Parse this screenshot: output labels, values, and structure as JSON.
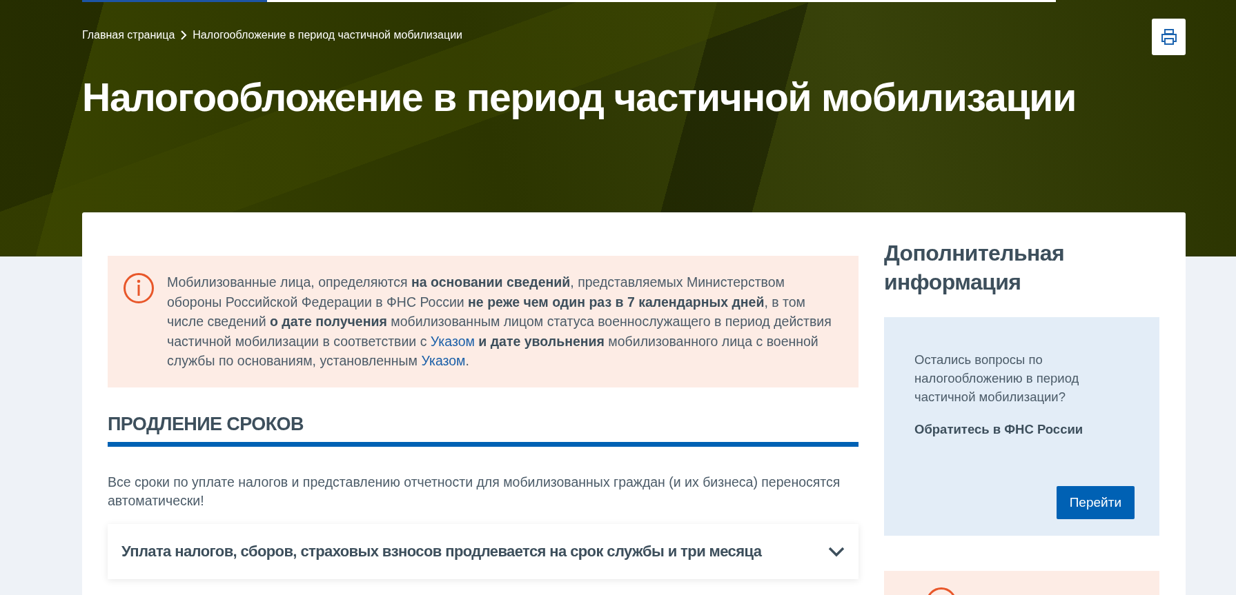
{
  "reading_progress": {
    "level": 0.19
  },
  "breadcrumbs": [
    {
      "label": "Главная страница"
    },
    {
      "label": "Налогообложение в период частичной мобилизации"
    }
  ],
  "title": "Налогообложение в период частичной мобилизации",
  "notice": {
    "segments": [
      {
        "kind": "text",
        "text": "Мобилизованные лица, определяются **на основании сведений**, представляемых Министерством обороны Российской Федерации в ФНС России **не реже чем один раз в 7 календарных дней**, в том числе сведений **о дате получения** мобилизованным лицом статуса военнослужащего в период действия частичной мобилизации в соответствии с "
      },
      {
        "kind": "link",
        "text": "Указом"
      },
      {
        "kind": "text",
        "text": " **и дате увольнения** мобилизованного лица с военной службы по основаниям, установленным "
      },
      {
        "kind": "link",
        "text": "Указом"
      },
      {
        "kind": "text",
        "text": "."
      }
    ]
  },
  "section": {
    "heading": "ПРОДЛЕНИЕ СРОКОВ",
    "text": "Все сроки по уплате налогов и представлению отчетности для мобилизованных граждан (и их бизнеса) переносятся автоматически!",
    "accordion": [
      {
        "title": "Уплата налогов, сборов, страховых взносов продлевается на срок службы и три месяца",
        "expanded": false
      }
    ]
  },
  "sidebar": {
    "heading": "Дополнительная информация",
    "contact": {
      "question": "Остались вопросы по налогообложению в период частичной мобилизации?",
      "action": "Обратитесь в ФНС России",
      "button": "Перейти"
    }
  }
}
